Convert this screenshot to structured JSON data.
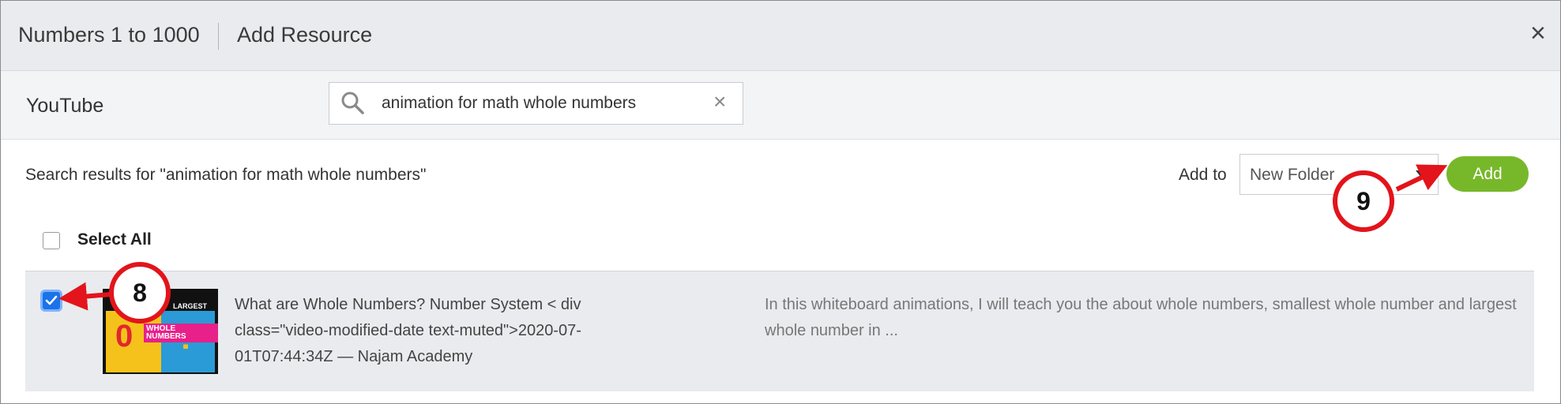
{
  "header": {
    "title": "Numbers 1 to 1000",
    "subtitle": "Add Resource",
    "close_icon": "close-icon"
  },
  "toolbar": {
    "source_label": "YouTube",
    "search": {
      "value": "animation for math whole numbers",
      "icon": "search-icon",
      "clear_icon": "clear-icon"
    }
  },
  "results": {
    "caption": "Search results for \"animation for math whole numbers\"",
    "add_to_label": "Add to",
    "folder_select_value": "New Folder",
    "add_button_label": "Add",
    "select_all_label": "Select All",
    "select_all_checked": false,
    "items": [
      {
        "checked": true,
        "thumbnail_icon": "video-thumbnail",
        "thumbnail_text": [
          "LARGEST",
          "WHOLE NUMBERS",
          "0",
          "?"
        ],
        "title": "What are Whole Numbers? Number System < div class=\"video-modified-date text-muted\">2020-07-01T07:44:34Z — Najam Academy",
        "description": "In this whiteboard animations, I will teach you the about whole numbers, smallest whole number and largest whole number in ..."
      }
    ]
  },
  "annotations": {
    "callout_8": "8",
    "callout_9": "9",
    "callout_color": "#e3141b"
  },
  "colors": {
    "add_button": "#77b82a",
    "checkbox_checked": "#1a73e8"
  }
}
